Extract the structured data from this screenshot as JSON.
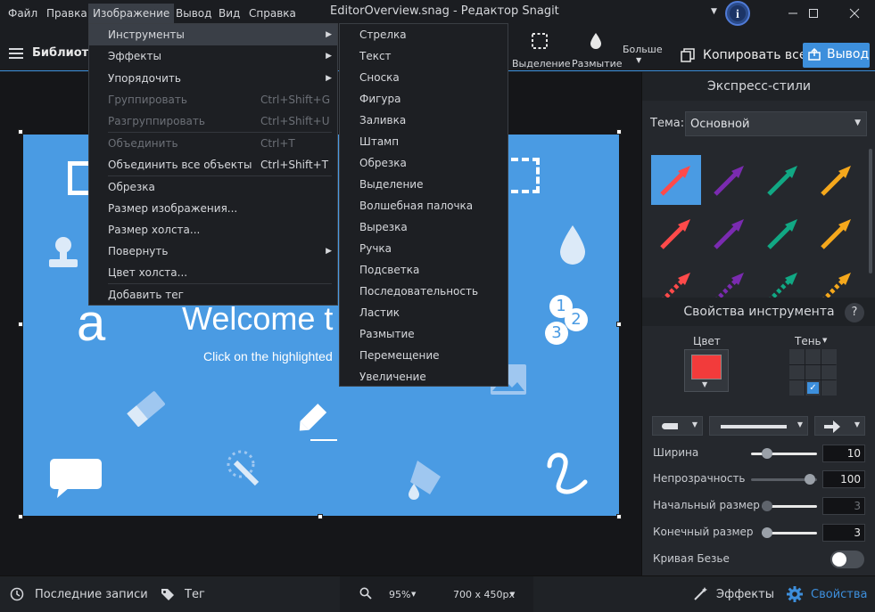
{
  "menubar": {
    "items": [
      "Файл",
      "Правка",
      "Изображение",
      "Вывод",
      "Вид",
      "Справка"
    ]
  },
  "window": {
    "title": "EditorOverview.snag - Редактор Snagit"
  },
  "toolbar": {
    "library_label": "Библиотека",
    "selection_label": "Выделение",
    "blur_label": "Размытие",
    "more_label": "Больше",
    "copy_all_label": "Копировать все",
    "output_label": "Вывод"
  },
  "image_menu": {
    "items": [
      {
        "label": "Инструменты",
        "shortcut": "",
        "submenu": true,
        "disabled": false
      },
      {
        "label": "Эффекты",
        "shortcut": "",
        "submenu": true,
        "disabled": false
      },
      {
        "label": "Упорядочить",
        "shortcut": "",
        "submenu": true,
        "disabled": false
      },
      {
        "label": "Группировать",
        "shortcut": "Ctrl+Shift+G",
        "submenu": false,
        "disabled": true
      },
      {
        "label": "Разгруппировать",
        "shortcut": "Ctrl+Shift+U",
        "submenu": false,
        "disabled": true
      },
      {
        "label": "Объединить",
        "shortcut": "Ctrl+T",
        "submenu": false,
        "disabled": true
      },
      {
        "label": "Объединить все объекты",
        "shortcut": "Ctrl+Shift+T",
        "submenu": false,
        "disabled": false
      },
      {
        "label": "Обрезка",
        "shortcut": "",
        "submenu": false,
        "disabled": false
      },
      {
        "label": "Размер изображения...",
        "shortcut": "",
        "submenu": false,
        "disabled": false
      },
      {
        "label": "Размер холста...",
        "shortcut": "",
        "submenu": false,
        "disabled": false
      },
      {
        "label": "Повернуть",
        "shortcut": "",
        "submenu": true,
        "disabled": false
      },
      {
        "label": "Цвет холста...",
        "shortcut": "",
        "submenu": false,
        "disabled": false
      },
      {
        "label": "Добавить тег",
        "shortcut": "",
        "submenu": false,
        "disabled": false
      }
    ]
  },
  "tools_menu": {
    "items": [
      "Стрелка",
      "Текст",
      "Сноска",
      "Фигура",
      "Заливка",
      "Штамп",
      "Обрезка",
      "Выделение",
      "Волшебная палочка",
      "Вырезка",
      "Ручка",
      "Подсветка",
      "Последовательность",
      "Ластик",
      "Размытие",
      "Перемещение",
      "Увеличение"
    ]
  },
  "canvas": {
    "welcome_text": "Welcome t",
    "subtitle_text": "Click on the highlighted",
    "letter_a": "a",
    "seq_1": "1",
    "seq_2": "2",
    "seq_3": "3"
  },
  "quick_styles": {
    "header": "Экспресс-стили",
    "theme_label": "Тема:",
    "theme_value": "Основной",
    "arrow_colors": [
      "#ff4a4a",
      "#7a2bb0",
      "#11a884",
      "#f5a81c"
    ]
  },
  "tool_properties": {
    "header": "Свойства инструмента",
    "help": "?",
    "color_label": "Цвет",
    "color_value": "#f23b3b",
    "shadow_label": "Тень",
    "width_label": "Ширина",
    "width_value": "10",
    "opacity_label": "Непрозрачность",
    "opacity_value": "100",
    "start_size_label": "Начальный размер",
    "start_size_value": "3",
    "end_size_label": "Конечный размер",
    "end_size_value": "3",
    "bezier_label": "Кривая Безье"
  },
  "statusbar": {
    "recent_label": "Последние записи",
    "tag_label": "Тег",
    "zoom_value": "95%",
    "size_value": "700 x 450px",
    "effects_label": "Эффекты",
    "properties_label": "Свойства"
  }
}
